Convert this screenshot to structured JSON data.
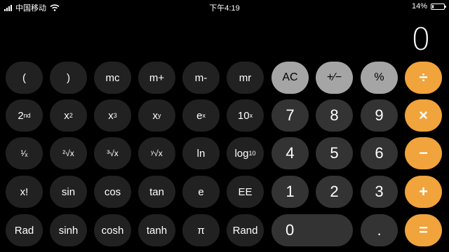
{
  "status_bar": {
    "carrier": "中国移动",
    "time": "下午4:19",
    "battery_percent": "14%",
    "battery_level": 0.14
  },
  "display": {
    "value": "0"
  },
  "keys": {
    "open_paren": "(",
    "close_paren": ")",
    "mc": "mc",
    "m_plus": "m+",
    "m_minus": "m-",
    "mr": "mr",
    "ac": "AC",
    "plus_minus": "+∕−",
    "percent": "%",
    "divide": "÷",
    "second_base": "2",
    "second_sup": "nd",
    "x_sq_base": "x",
    "x_sq_sup": "2",
    "x_cube_base": "x",
    "x_cube_sup": "3",
    "x_y_base": "x",
    "x_y_sup": "y",
    "e_x_base": "e",
    "e_x_sup": "x",
    "ten_x_base": "10",
    "ten_x_sup": "x",
    "seven": "7",
    "eight": "8",
    "nine": "9",
    "multiply": "×",
    "reciprocal": "¹∕ₓ",
    "sqrt2": "²√x",
    "sqrt3": "³√x",
    "sqrty": "ʸ√x",
    "ln": "ln",
    "log_base": "log",
    "log_sub": "10",
    "four": "4",
    "five": "5",
    "six": "6",
    "minus": "−",
    "factorial": "x!",
    "sin": "sin",
    "cos": "cos",
    "tan": "tan",
    "e": "e",
    "ee": "EE",
    "one": "1",
    "two": "2",
    "three": "3",
    "plus": "+",
    "rad": "Rad",
    "sinh": "sinh",
    "cosh": "cosh",
    "tanh": "tanh",
    "pi": "π",
    "rand": "Rand",
    "zero": "0",
    "decimal": ".",
    "equals": "="
  },
  "colors": {
    "background": "#000000",
    "scientific_key": "#212121",
    "number_key": "#333333",
    "function_key": "#a5a5a5",
    "operator_key": "#f1a33c"
  }
}
